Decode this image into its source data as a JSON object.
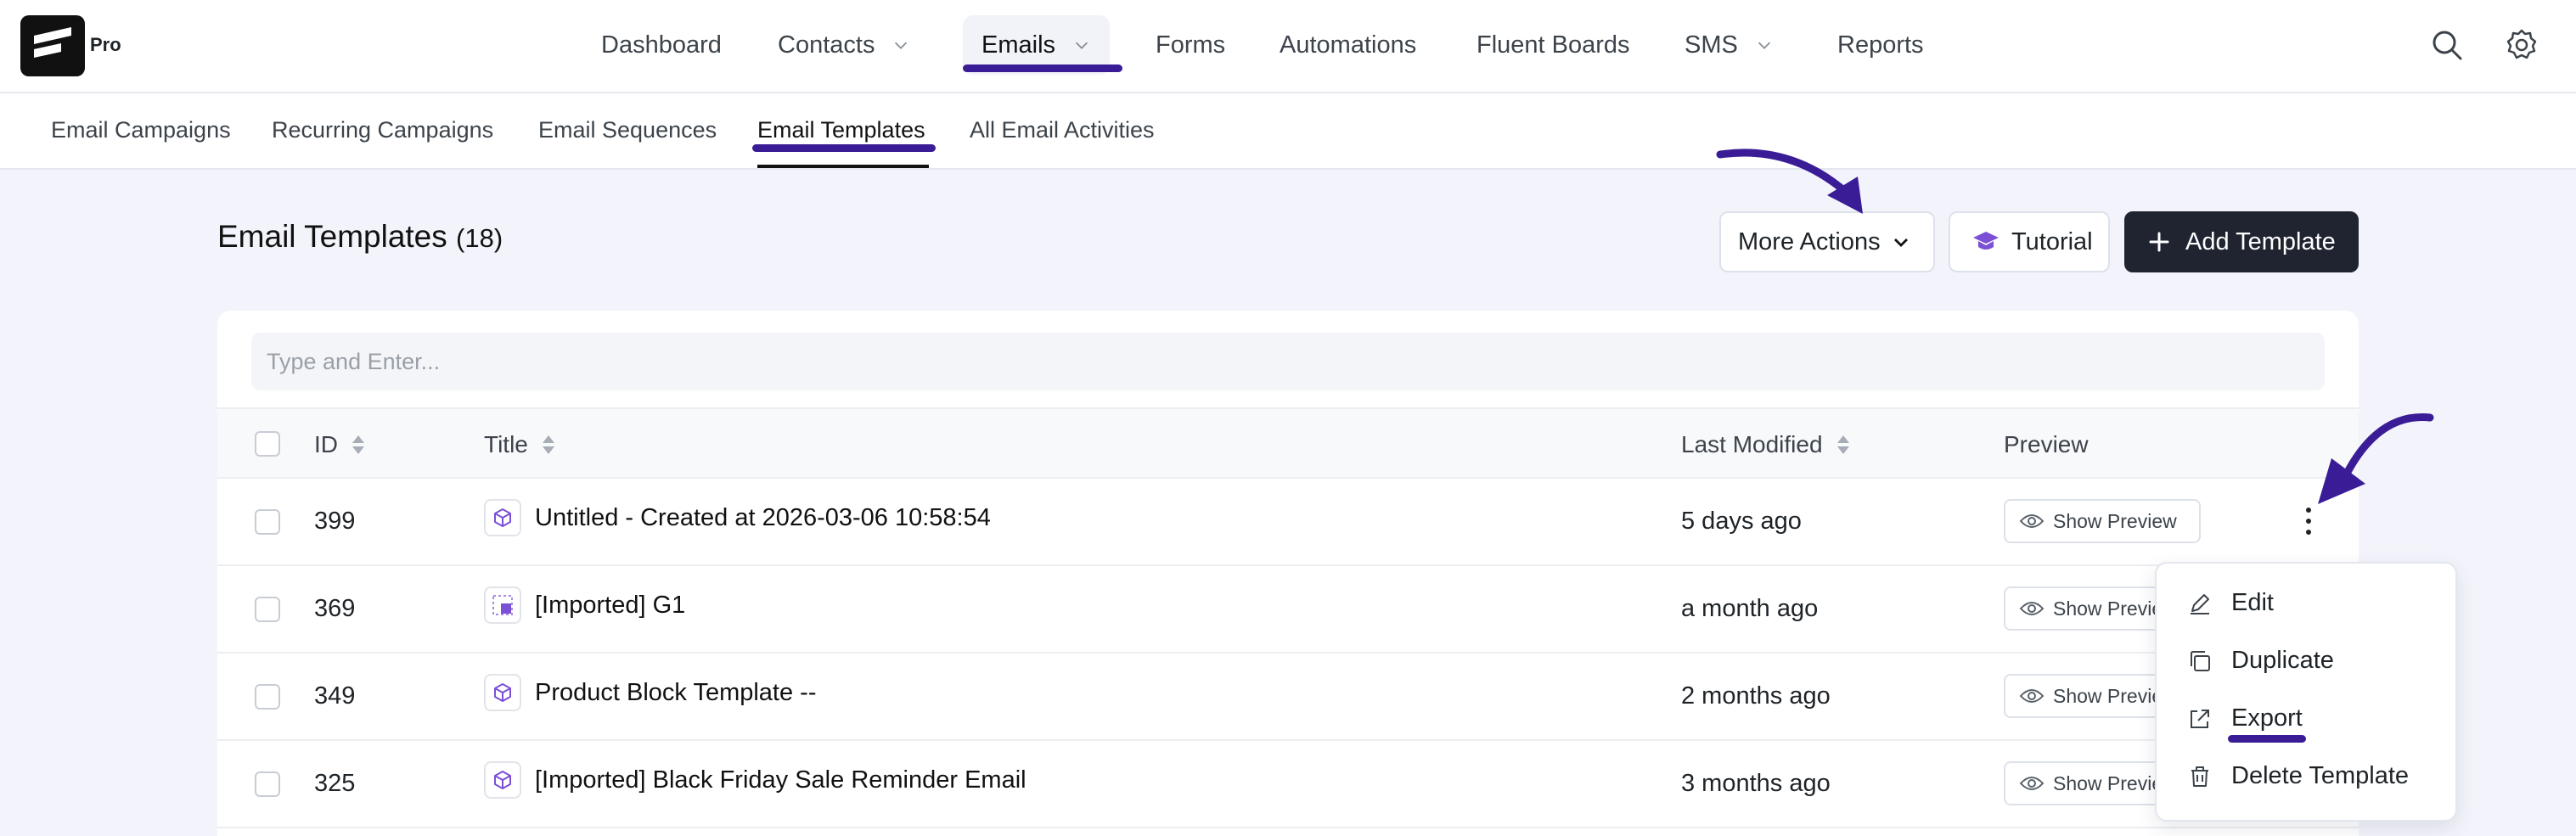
{
  "brand": {
    "badge": "Pro"
  },
  "nav": {
    "items": [
      {
        "label": "Dashboard"
      },
      {
        "label": "Contacts"
      },
      {
        "label": "Emails"
      },
      {
        "label": "Forms"
      },
      {
        "label": "Automations"
      },
      {
        "label": "Fluent Boards"
      },
      {
        "label": "SMS"
      },
      {
        "label": "Reports"
      }
    ],
    "active": "Emails"
  },
  "subnav": {
    "items": [
      {
        "label": "Email Campaigns"
      },
      {
        "label": "Recurring Campaigns"
      },
      {
        "label": "Email Sequences"
      },
      {
        "label": "Email Templates"
      },
      {
        "label": "All Email Activities"
      }
    ],
    "active": "Email Templates"
  },
  "page": {
    "title": "Email Templates",
    "count": "(18)"
  },
  "actions": {
    "more": "More Actions",
    "tutorial": "Tutorial",
    "add": "Add Template"
  },
  "search": {
    "placeholder": "Type and Enter..."
  },
  "table": {
    "columns": {
      "id": "ID",
      "title": "Title",
      "modified": "Last Modified",
      "preview": "Preview"
    },
    "preview_label": "Show Preview",
    "rows": [
      {
        "id": "399",
        "title": "Untitled - Created at 2026-03-06 10:58:54",
        "modified": "5 days ago",
        "icon": "cube-icon"
      },
      {
        "id": "369",
        "title": "[Imported] G1",
        "modified": "a month ago",
        "icon": "grid-import-icon"
      },
      {
        "id": "349",
        "title": "Product Block Template --",
        "modified": "2 months ago",
        "icon": "cube-icon"
      },
      {
        "id": "325",
        "title": "[Imported] Black Friday Sale Reminder Email",
        "modified": "3 months ago",
        "icon": "cube-icon"
      }
    ]
  },
  "row_menu": {
    "items": [
      {
        "label": "Edit",
        "icon": "pencil-icon"
      },
      {
        "label": "Duplicate",
        "icon": "copy-icon"
      },
      {
        "label": "Export",
        "icon": "export-icon"
      },
      {
        "label": "Delete Template",
        "icon": "trash-icon"
      }
    ]
  },
  "colors": {
    "accent": "#3a1d96",
    "dark_button": "#1f2430",
    "background": "#f3f4fb",
    "tutorial_icon": "#7b4fd6"
  }
}
